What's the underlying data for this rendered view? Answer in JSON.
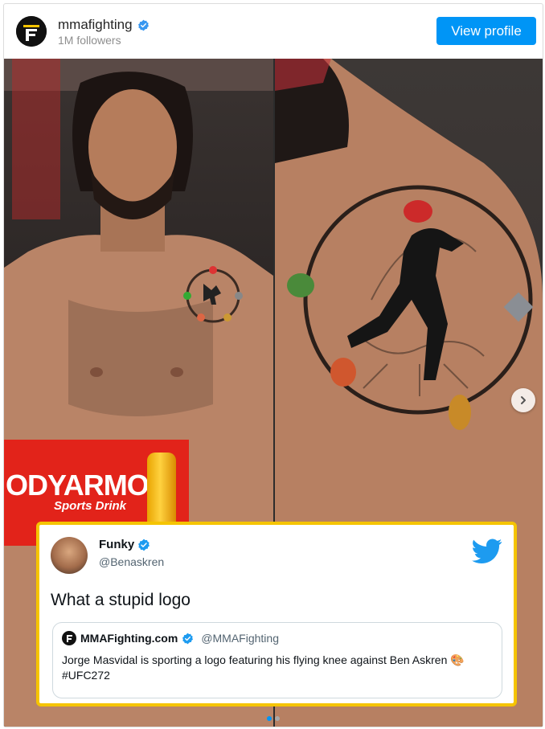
{
  "header": {
    "profile_name": "mmafighting",
    "followers": "1M followers",
    "view_profile_label": "View profile"
  },
  "media": {
    "sponsor_brand": "ODYARMOR",
    "sponsor_sub": "Sports Drink",
    "carousel_slide_count": 2,
    "carousel_active_index": 1
  },
  "tweet": {
    "name": "Funky",
    "handle": "@Benaskren",
    "text": "What a stupid logo",
    "quote": {
      "name": "MMAFighting.com",
      "handle": "@MMAFighting",
      "text": "Jorge Masvidal is sporting a logo featuring his flying knee against Ben Askren 🎨 #UFC272"
    }
  },
  "colors": {
    "accent": "#0095f6",
    "verified": "#3897f0",
    "twitter_blue": "#1d9bf0",
    "tweet_border": "#f5c400",
    "sponsor_red": "#e2231a"
  }
}
